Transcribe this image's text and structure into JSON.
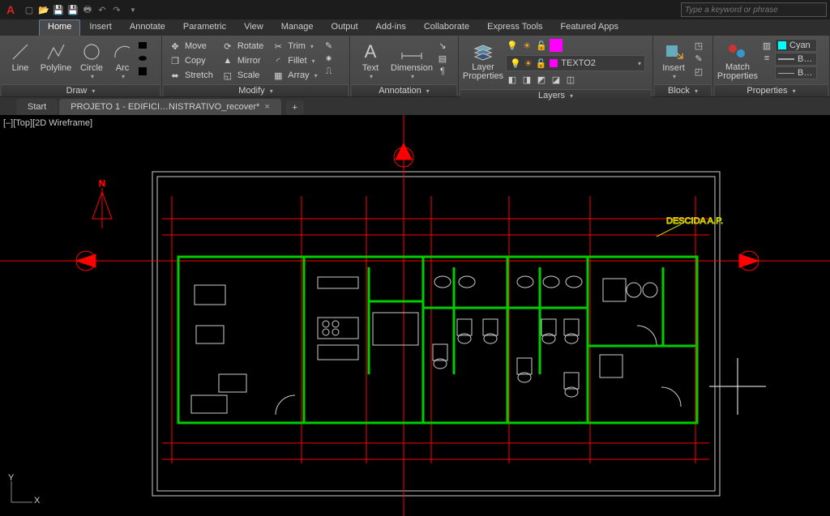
{
  "app_logo_letter": "A",
  "searchbox_placeholder": "Type a keyword or phrase",
  "tabs": {
    "home": "Home",
    "insert": "Insert",
    "annotate": "Annotate",
    "parametric": "Parametric",
    "view": "View",
    "manage": "Manage",
    "output": "Output",
    "addins": "Add-ins",
    "collaborate": "Collaborate",
    "express": "Express Tools",
    "featured": "Featured Apps"
  },
  "draw": {
    "line": "Line",
    "polyline": "Polyline",
    "circle": "Circle",
    "arc": "Arc",
    "panel": "Draw"
  },
  "modify": {
    "move": "Move",
    "copy": "Copy",
    "stretch": "Stretch",
    "rotate": "Rotate",
    "mirror": "Mirror",
    "scale": "Scale",
    "trim": "Trim",
    "fillet": "Fillet",
    "array": "Array",
    "panel": "Modify"
  },
  "annotation": {
    "text": "Text",
    "dimension": "Dimension",
    "panel": "Annotation"
  },
  "layers": {
    "properties": "Layer\nProperties",
    "current": "TEXTO2",
    "panel": "Layers"
  },
  "block": {
    "insert": "Insert",
    "panel": "Block"
  },
  "properties": {
    "match": "Match\nProperties",
    "color": "Cyan",
    "panel": "Properties"
  },
  "filetabs": {
    "start": "Start",
    "project": "PROJETO 1 - EDIFICI…NISTRATIVO_recover*"
  },
  "viewport_label": "[–][Top][2D Wireframe]",
  "ucs": {
    "y": "Y",
    "x": "X"
  }
}
